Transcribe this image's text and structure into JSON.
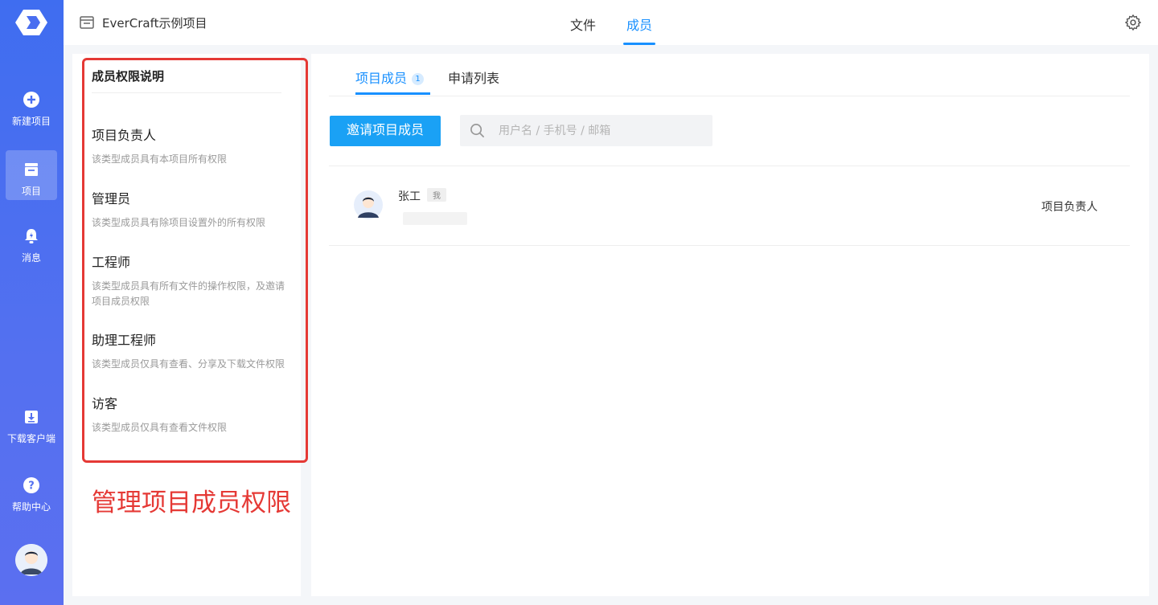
{
  "sidebar": {
    "items": [
      {
        "label": "新建项目",
        "icon": "plus-circle-icon"
      },
      {
        "label": "项目",
        "icon": "project-icon",
        "active": true
      },
      {
        "label": "消息",
        "icon": "bell-icon"
      },
      {
        "label": "下载客户端",
        "icon": "download-icon"
      },
      {
        "label": "帮助中心",
        "icon": "help-icon"
      }
    ]
  },
  "header": {
    "project_name": "EverCraft示例项目",
    "tabs": [
      {
        "label": "文件",
        "active": false
      },
      {
        "label": "成员",
        "active": true
      }
    ]
  },
  "permissions": {
    "title": "成员权限说明",
    "roles": [
      {
        "name": "项目负责人",
        "desc": "该类型成员具有本项目所有权限"
      },
      {
        "name": "管理员",
        "desc": "该类型成员具有除项目设置外的所有权限"
      },
      {
        "name": "工程师",
        "desc": "该类型成员具有所有文件的操作权限，及邀请项目成员权限"
      },
      {
        "name": "助理工程师",
        "desc": "该类型成员仅具有查看、分享及下载文件权限"
      },
      {
        "name": "访客",
        "desc": "该类型成员仅具有查看文件权限"
      }
    ]
  },
  "annotation": "管理项目成员权限",
  "main": {
    "tabs": [
      {
        "label": "项目成员",
        "count": "1",
        "active": true
      },
      {
        "label": "申请列表",
        "active": false
      }
    ],
    "invite_button": "邀请项目成员",
    "search_placeholder": "用户名 / 手机号 / 邮箱",
    "members": [
      {
        "name": "张工",
        "tag": "我",
        "role": "项目负责人"
      }
    ]
  },
  "colors": {
    "accent": "#1890ff",
    "sidebar": "#4a6ef0",
    "annotation_red": "#e53935",
    "button": "#1aa1f5"
  }
}
